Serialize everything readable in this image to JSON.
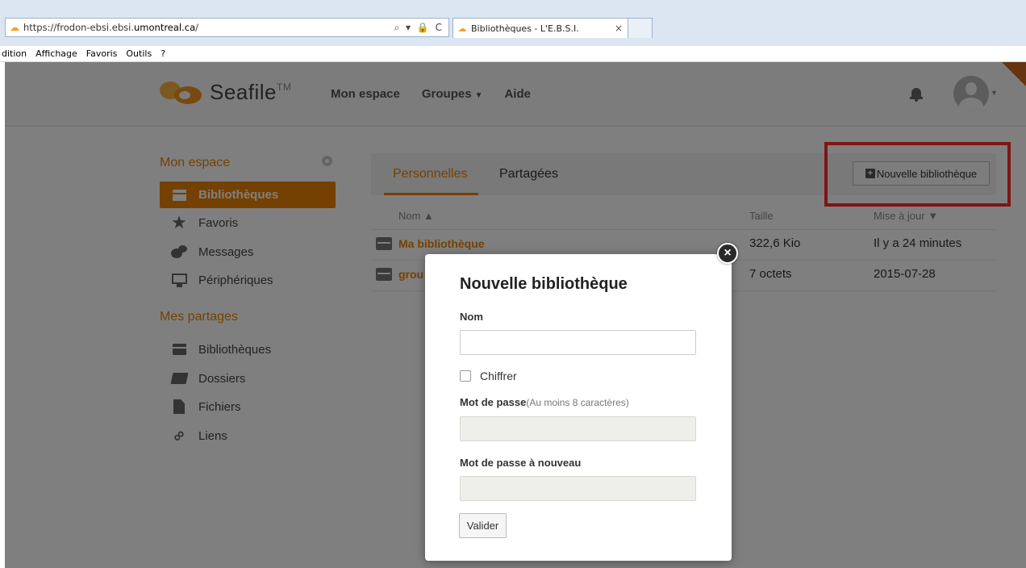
{
  "browser": {
    "url_prefix": "https://frodon-ebsi.ebsi.",
    "url_domain": "umontreal.ca",
    "url_suffix": "/",
    "addr_tools": "⌕ ▾ 🔒 C",
    "tab_title": "Bibliothèques - L'E.B.S.I.",
    "tab_close": "×",
    "menu": [
      "dition",
      "Affichage",
      "Favoris",
      "Outils",
      "?"
    ]
  },
  "header": {
    "logo_text": "Seafile",
    "logo_tm": "TM",
    "nav": [
      "Mon espace",
      "Groupes",
      "Aide"
    ],
    "groups_caret": "▼",
    "avatar_caret": "▼"
  },
  "sidebar": {
    "section1_title": "Mon espace",
    "items": [
      {
        "label": "Bibliothèques",
        "icon": "library-icon",
        "active": true
      },
      {
        "label": "Favoris",
        "icon": "star-icon"
      },
      {
        "label": "Messages",
        "icon": "messages-icon"
      },
      {
        "label": "Périphériques",
        "icon": "monitor-icon"
      }
    ],
    "section2_title": "Mes partages",
    "share_items": [
      {
        "label": "Bibliothèques",
        "icon": "library-icon"
      },
      {
        "label": "Dossiers",
        "icon": "folder-icon"
      },
      {
        "label": "Fichiers",
        "icon": "file-icon"
      },
      {
        "label": "Liens",
        "icon": "link-icon"
      }
    ]
  },
  "main": {
    "tabs": [
      "Personnelles",
      "Partagées"
    ],
    "new_library_button": "Nouvelle bibliothèque",
    "columns": {
      "name": "Nom ▲",
      "size": "Taille",
      "updated": "Mise à jour ▼"
    },
    "rows": [
      {
        "name": "Ma bibliothèque",
        "size": "322,6 Kio",
        "updated": "Il y a 24 minutes"
      },
      {
        "name": "grou",
        "size": "7 octets",
        "updated": "2015-07-28"
      }
    ]
  },
  "modal": {
    "title": "Nouvelle bibliothèque",
    "name_label": "Nom",
    "name_value": "",
    "encrypt_label": "Chiffrer",
    "encrypt_checked": false,
    "password_label": "Mot de passe",
    "password_hint": "(Au moins 8 caractères)",
    "password_again_label": "Mot de passe à nouveau",
    "submit_label": "Valider",
    "close_symbol": "×"
  },
  "colors": {
    "accent": "#eb8205",
    "highlight": "#ff2b2b",
    "overlay": "rgba(0,0,0,0.5)"
  }
}
